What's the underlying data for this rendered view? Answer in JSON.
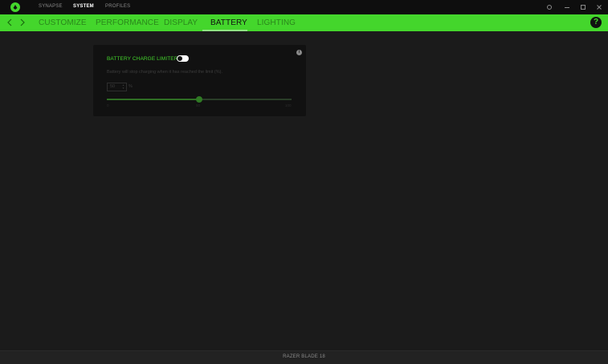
{
  "titlebar": {
    "tabs": [
      {
        "label": "SYNAPSE",
        "active": false
      },
      {
        "label": "SYSTEM",
        "active": true
      },
      {
        "label": "PROFILES",
        "active": false
      }
    ],
    "icons": {
      "logo": "razer-logo-icon",
      "settings": "gear-icon",
      "minimize": "minimize-icon",
      "maximize": "maximize-icon",
      "close": "close-icon"
    }
  },
  "nav": {
    "tabs": [
      {
        "label": "CUSTOMIZE",
        "active": false
      },
      {
        "label": "PERFORMANCE",
        "active": false
      },
      {
        "label": "DISPLAY",
        "active": false
      },
      {
        "label": "BATTERY",
        "active": true
      },
      {
        "label": "LIGHTING",
        "active": false
      }
    ],
    "help_label": "?"
  },
  "battery": {
    "title": "BATTERY CHARGE LIMITER",
    "toggle_on": false,
    "description": "Battery will stop charging when it has reached the limit (%).",
    "limit_value": "50",
    "unit": "%",
    "slider": {
      "min": 0,
      "max": 100,
      "value": 50
    },
    "tick_labels": [
      "0",
      "50",
      "100"
    ]
  },
  "footer": {
    "device": "RAZER BLADE 18"
  },
  "colors": {
    "accent": "#44d62c",
    "background": "#1b1b1b",
    "card": "#111111",
    "titlebar": "#0e0e0e"
  }
}
